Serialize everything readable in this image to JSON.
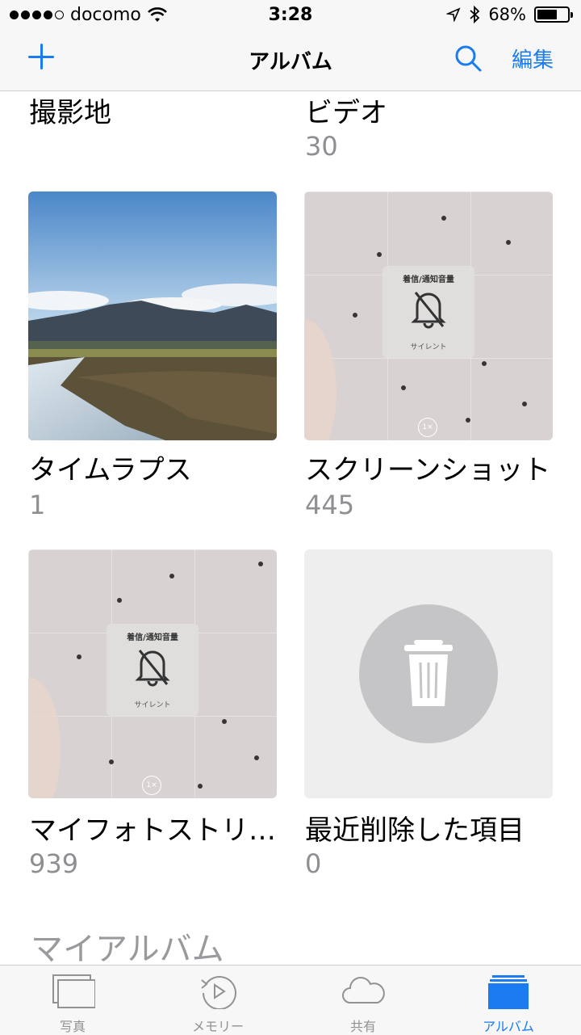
{
  "status_bar": {
    "carrier": "docomo",
    "time": "3:28",
    "battery_percent": "68%",
    "battery_level": 0.68
  },
  "nav": {
    "title": "アルバム",
    "edit_label": "編集",
    "add_icon": "plus-icon",
    "search_icon": "search-icon"
  },
  "albums": [
    {
      "name": "撮影地",
      "count": ""
    },
    {
      "name": "ビデオ",
      "count": "30"
    },
    {
      "name": "タイムラプス",
      "count": "1"
    },
    {
      "name": "スクリーンショット",
      "count": "445"
    },
    {
      "name": "マイフォトストリ…",
      "count": "939"
    },
    {
      "name": "最近削除した項目",
      "count": "0"
    }
  ],
  "screenshot_overlay": {
    "title": "着信/通知音量",
    "subtitle": "サイレント",
    "zoom": "1×"
  },
  "section": {
    "my_albums": "マイアルバム"
  },
  "tabs": [
    {
      "label": "写真",
      "icon": "photos-icon"
    },
    {
      "label": "メモリー",
      "icon": "memories-icon"
    },
    {
      "label": "共有",
      "icon": "cloud-icon"
    },
    {
      "label": "アルバム",
      "icon": "albums-icon"
    }
  ],
  "colors": {
    "accent": "#1a7cf0",
    "secondary_text": "#8e8e93"
  }
}
